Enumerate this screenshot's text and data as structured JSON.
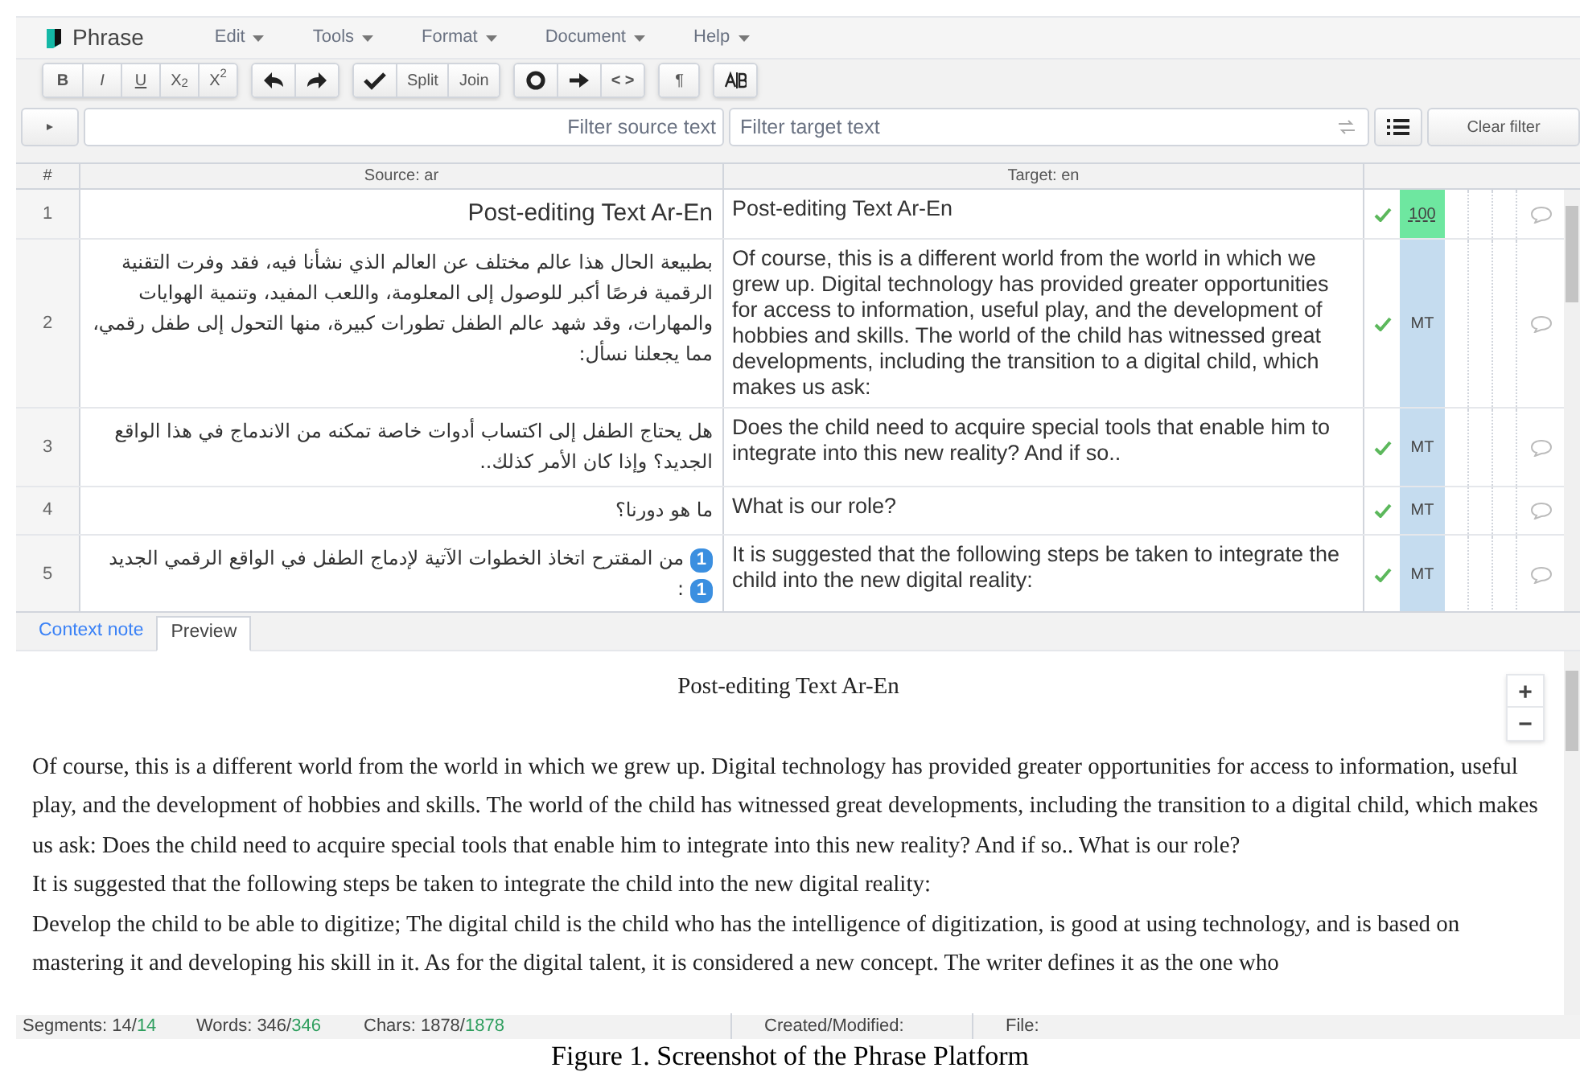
{
  "app": {
    "name": "Phrase"
  },
  "menu": [
    "Edit",
    "Tools",
    "Format",
    "Document",
    "Help"
  ],
  "toolbar": [
    [
      {
        "kind": "text",
        "text": "**B**"
      },
      {
        "kind": "text",
        "text": "*I*"
      },
      {
        "kind": "underline",
        "text": "U"
      },
      {
        "kind": "text",
        "text": "X$_{2}$"
      },
      {
        "kind": "text",
        "text": "X$^{2}$"
      }
    ],
    [
      {
        "kind": "undo-icon"
      },
      {
        "kind": "redo-icon"
      }
    ],
    [
      {
        "kind": "check-icon"
      },
      {
        "kind": "text",
        "text": "Split"
      },
      {
        "kind": "text",
        "text": "Join"
      }
    ],
    [
      {
        "kind": "circle-icon"
      },
      {
        "kind": "arrow-icon"
      },
      {
        "kind": "text",
        "text": "**< >**"
      }
    ],
    [
      {
        "kind": "text",
        "text": "¶"
      }
    ],
    [
      {
        "kind": "ab-icon"
      }
    ]
  ],
  "filters": {
    "source_placeholder": "Filter source text",
    "target_placeholder": "Filter target text",
    "clear": "Clear filter"
  },
  "table": {
    "columns": [
      "#",
      "Source: ar",
      "Target: en"
    ],
    "rows": [
      {
        "number": "1",
        "source": [
          {
            "kind": "text",
            "text": "Post-editing Text Ar-En"
          }
        ],
        "target": "Post-editing Text Ar-En",
        "confirmed": true,
        "match": {
          "kind": "tm",
          "text": "100"
        }
      },
      {
        "number": "2",
        "source": [
          {
            "kind": "text",
            "text": "بطبيعة الحال هذا عالم مختلف عن العالم الذي نشأنا فيه، فقد وفرت التقنية الرقمية فرصًا أكبر للوصول إلى المعلومة، واللعب المفيد، وتنمية الهوايات والمهارات، وقد شهد عالم الطفل تطورات كبيرة، منها التحول إلى طفل رقمي، مما يجعلنا نسأل:"
          }
        ],
        "target": "Of course, this is a different world from the world in which we grew up. Digital technology has provided greater opportunities for access to information, useful play, and the development of hobbies and skills. The world of the child has witnessed great developments, including the transition to a digital child, which makes us ask:",
        "confirmed": true,
        "match": {
          "kind": "mt",
          "text": "MT"
        }
      },
      {
        "number": "3",
        "source": [
          {
            "kind": "text",
            "text": "هل يحتاج الطفل إلى اكتساب أدوات خاصة تمكنه من الاندماج في هذا الواقع الجديد؟ وإذا كان الأمر كذلك.."
          }
        ],
        "target": "Does the child need to acquire special tools that enable him to integrate into this new reality? And if so..",
        "confirmed": true,
        "match": {
          "kind": "mt",
          "text": "MT"
        }
      },
      {
        "number": "4",
        "source": [
          {
            "kind": "text",
            "text": "ما هو دورنا؟"
          }
        ],
        "target": "What is our role?",
        "confirmed": true,
        "match": {
          "kind": "mt",
          "text": "MT"
        }
      },
      {
        "number": "5",
        "source": [
          {
            "kind": "text",
            "text": "**1** من المقترح اتخاذ الخطوات الآتية لإدماج الطفل في الواقع الرقمي الجديد **1** :"
          }
        ],
        "target": "It is suggested that the following steps be taken to integrate the child into the new digital reality:",
        "confirmed": true,
        "match": {
          "kind": "mt",
          "text": "MT"
        }
      }
    ]
  },
  "tabs": [
    {
      "label": "Context note",
      "selected": false
    },
    {
      "label": "Preview",
      "selected": true
    }
  ],
  "preview": {
    "title": "Post-editing Text Ar-En",
    "paragraphs": [
      "Of course, this is a different world from the world in which we grew up. Digital technology has provided greater opportunities for access to information, useful play, and the development of hobbies and skills. The world of the child has witnessed great developments, including the transition to a digital child, which makes us ask: Does the child need to acquire special tools that enable him to integrate into this new reality? And if so.. What is our role?",
      "It is suggested that the following steps be taken to integrate the child into the new digital reality:",
      "Develop the child to be able to digitize; The digital child is the child who has the intelligence of digitization, is good at using technology, and is based on mastering it and developing his skill in it. As for the digital talent, it is considered a new concept. The writer defines it as the one who"
    ],
    "zoom_in": "+",
    "zoom_out": "−"
  },
  "status_bar": [
    {
      "label": "Segments:",
      "value": "14/",
      "total": "14"
    },
    {
      "label": "Words:",
      "value": "346/",
      "total": "346"
    },
    {
      "label": "Chars:",
      "value": "1878/",
      "total": "1878"
    },
    {
      "label": "Created/Modified:"
    },
    {
      "label": "File:"
    }
  ],
  "caption": "Figure 1. Screenshot of the Phrase Platform"
}
